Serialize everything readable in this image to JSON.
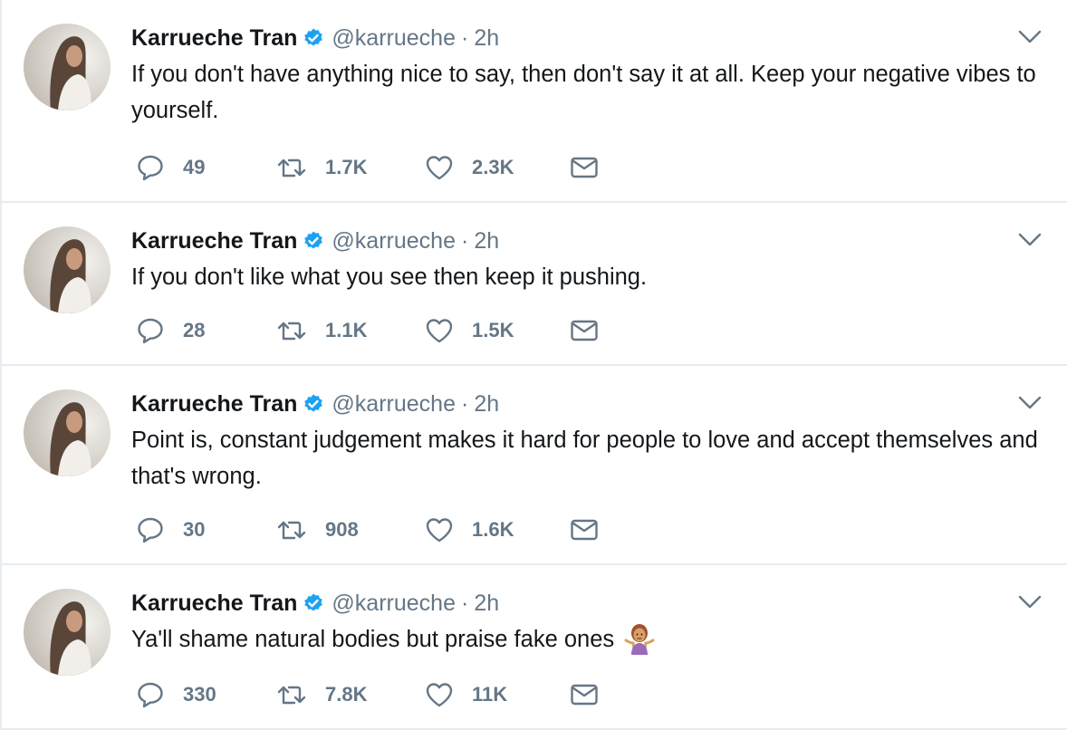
{
  "icons": {
    "verified": "verified-badge-icon",
    "caret": "chevron-down-icon",
    "reply": "reply-bubble-icon",
    "retweet": "retweet-icon",
    "like": "heart-icon",
    "dm": "envelope-icon",
    "emoji": "person-shrugging-emoji"
  },
  "colors": {
    "text": "#14171a",
    "secondary": "#657786",
    "verified": "#1da1f2",
    "divider": "#e6ecf0"
  },
  "tweets": [
    {
      "name": "Karrueche Tran",
      "handle": "@karrueche",
      "separator": "·",
      "time": "2h",
      "text": "If you don't have anything nice to say, then don't say it at all. Keep your negative vibes to yourself.",
      "replies": "49",
      "retweets": "1.7K",
      "likes": "2.3K"
    },
    {
      "name": "Karrueche Tran",
      "handle": "@karrueche",
      "separator": "·",
      "time": "2h",
      "text": "If you don't like what you see then keep it pushing.",
      "replies": "28",
      "retweets": "1.1K",
      "likes": "1.5K"
    },
    {
      "name": "Karrueche Tran",
      "handle": "@karrueche",
      "separator": "·",
      "time": "2h",
      "text": "Point is, constant judgement makes it hard for people to love and accept themselves and that's wrong.",
      "replies": "30",
      "retweets": "908",
      "likes": "1.6K"
    },
    {
      "name": "Karrueche Tran",
      "handle": "@karrueche",
      "separator": "·",
      "time": "2h",
      "text": "Ya'll shame natural bodies but praise fake ones",
      "replies": "330",
      "retweets": "7.8K",
      "likes": "11K"
    }
  ]
}
